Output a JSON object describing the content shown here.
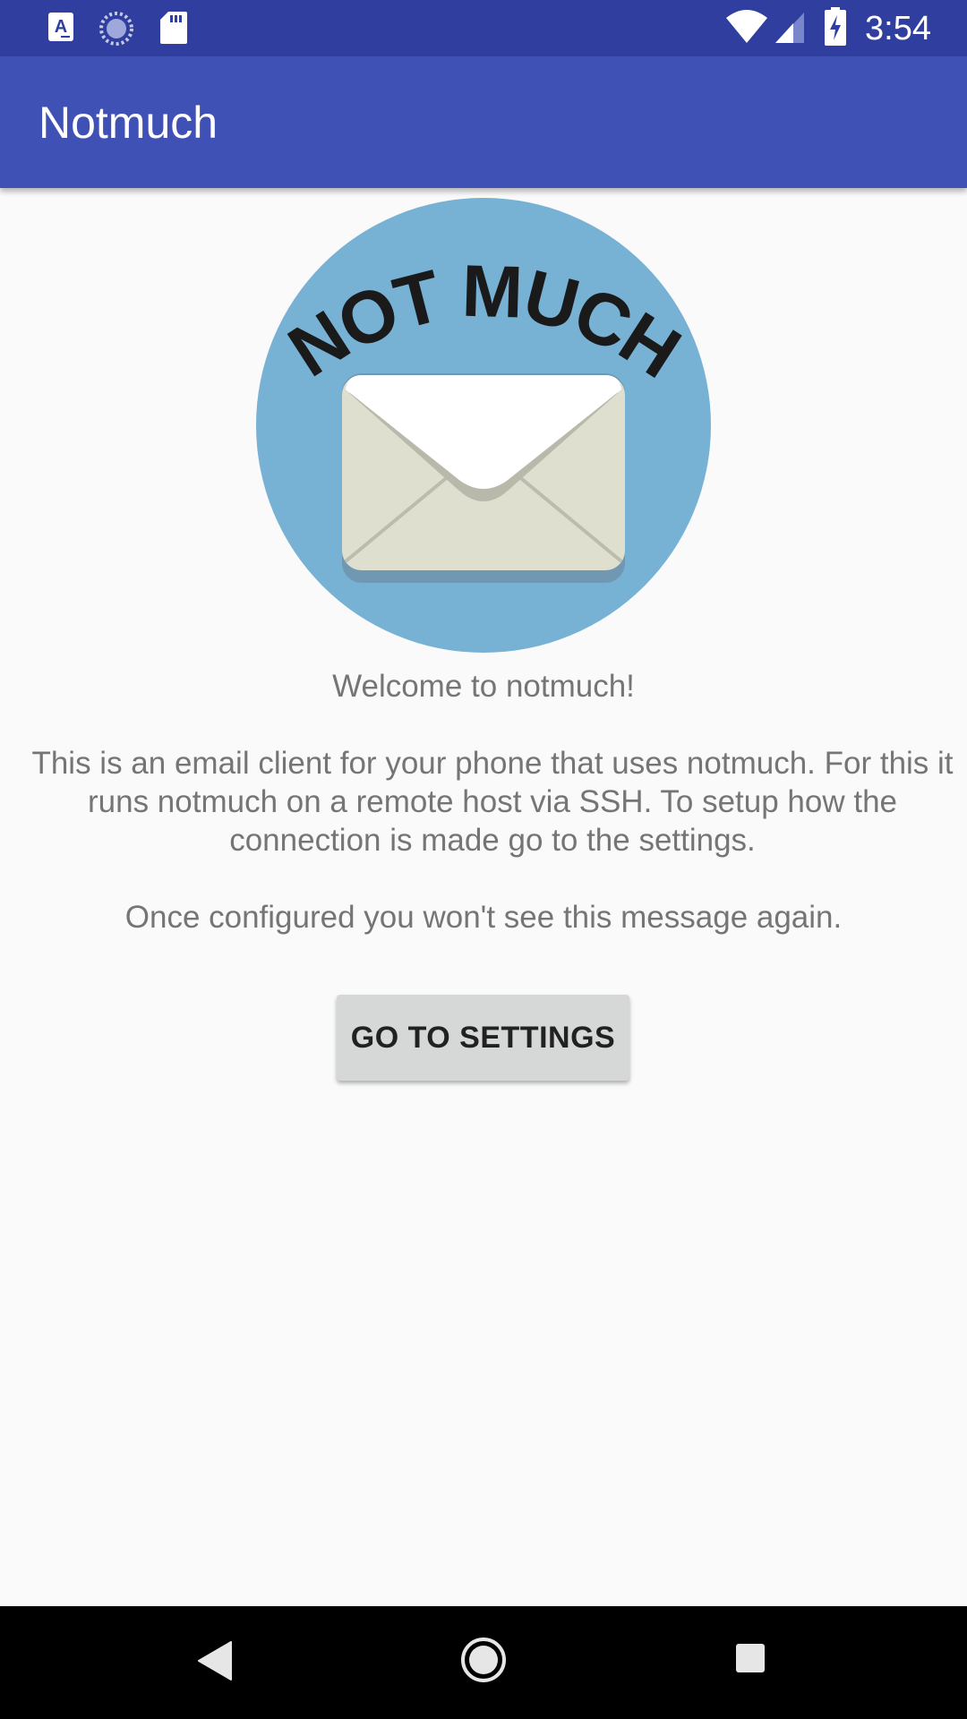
{
  "status_bar": {
    "time": "3:54",
    "left_icons": [
      "text-a-notification-icon",
      "sync-progress-icon",
      "sd-card-icon"
    ],
    "right_icons": [
      "wifi-icon",
      "cell-signal-icon",
      "battery-charging-icon"
    ]
  },
  "app_bar": {
    "title": "Notmuch"
  },
  "logo": {
    "text": "NOT MUCH",
    "colors": {
      "circle": "#77b2d5",
      "envelope": "#dfdfcf",
      "flap": "#ffffff"
    }
  },
  "content": {
    "welcome": "Welcome to notmuch!",
    "description": "This is an email client for your phone that uses notmuch. For this it runs notmuch on a remote host via SSH. To setup how the connection is made go to the settings.",
    "once_configured": "Once configured you won't see this message again.",
    "button_label": "GO TO SETTINGS"
  },
  "nav_bar": {
    "buttons": [
      "back-icon",
      "home-icon",
      "recents-icon"
    ]
  },
  "colors": {
    "status_bar": "#303f9f",
    "app_bar": "#3f51b5",
    "background": "#fafafa",
    "text": "#757575",
    "button": "#d6d7d7"
  }
}
